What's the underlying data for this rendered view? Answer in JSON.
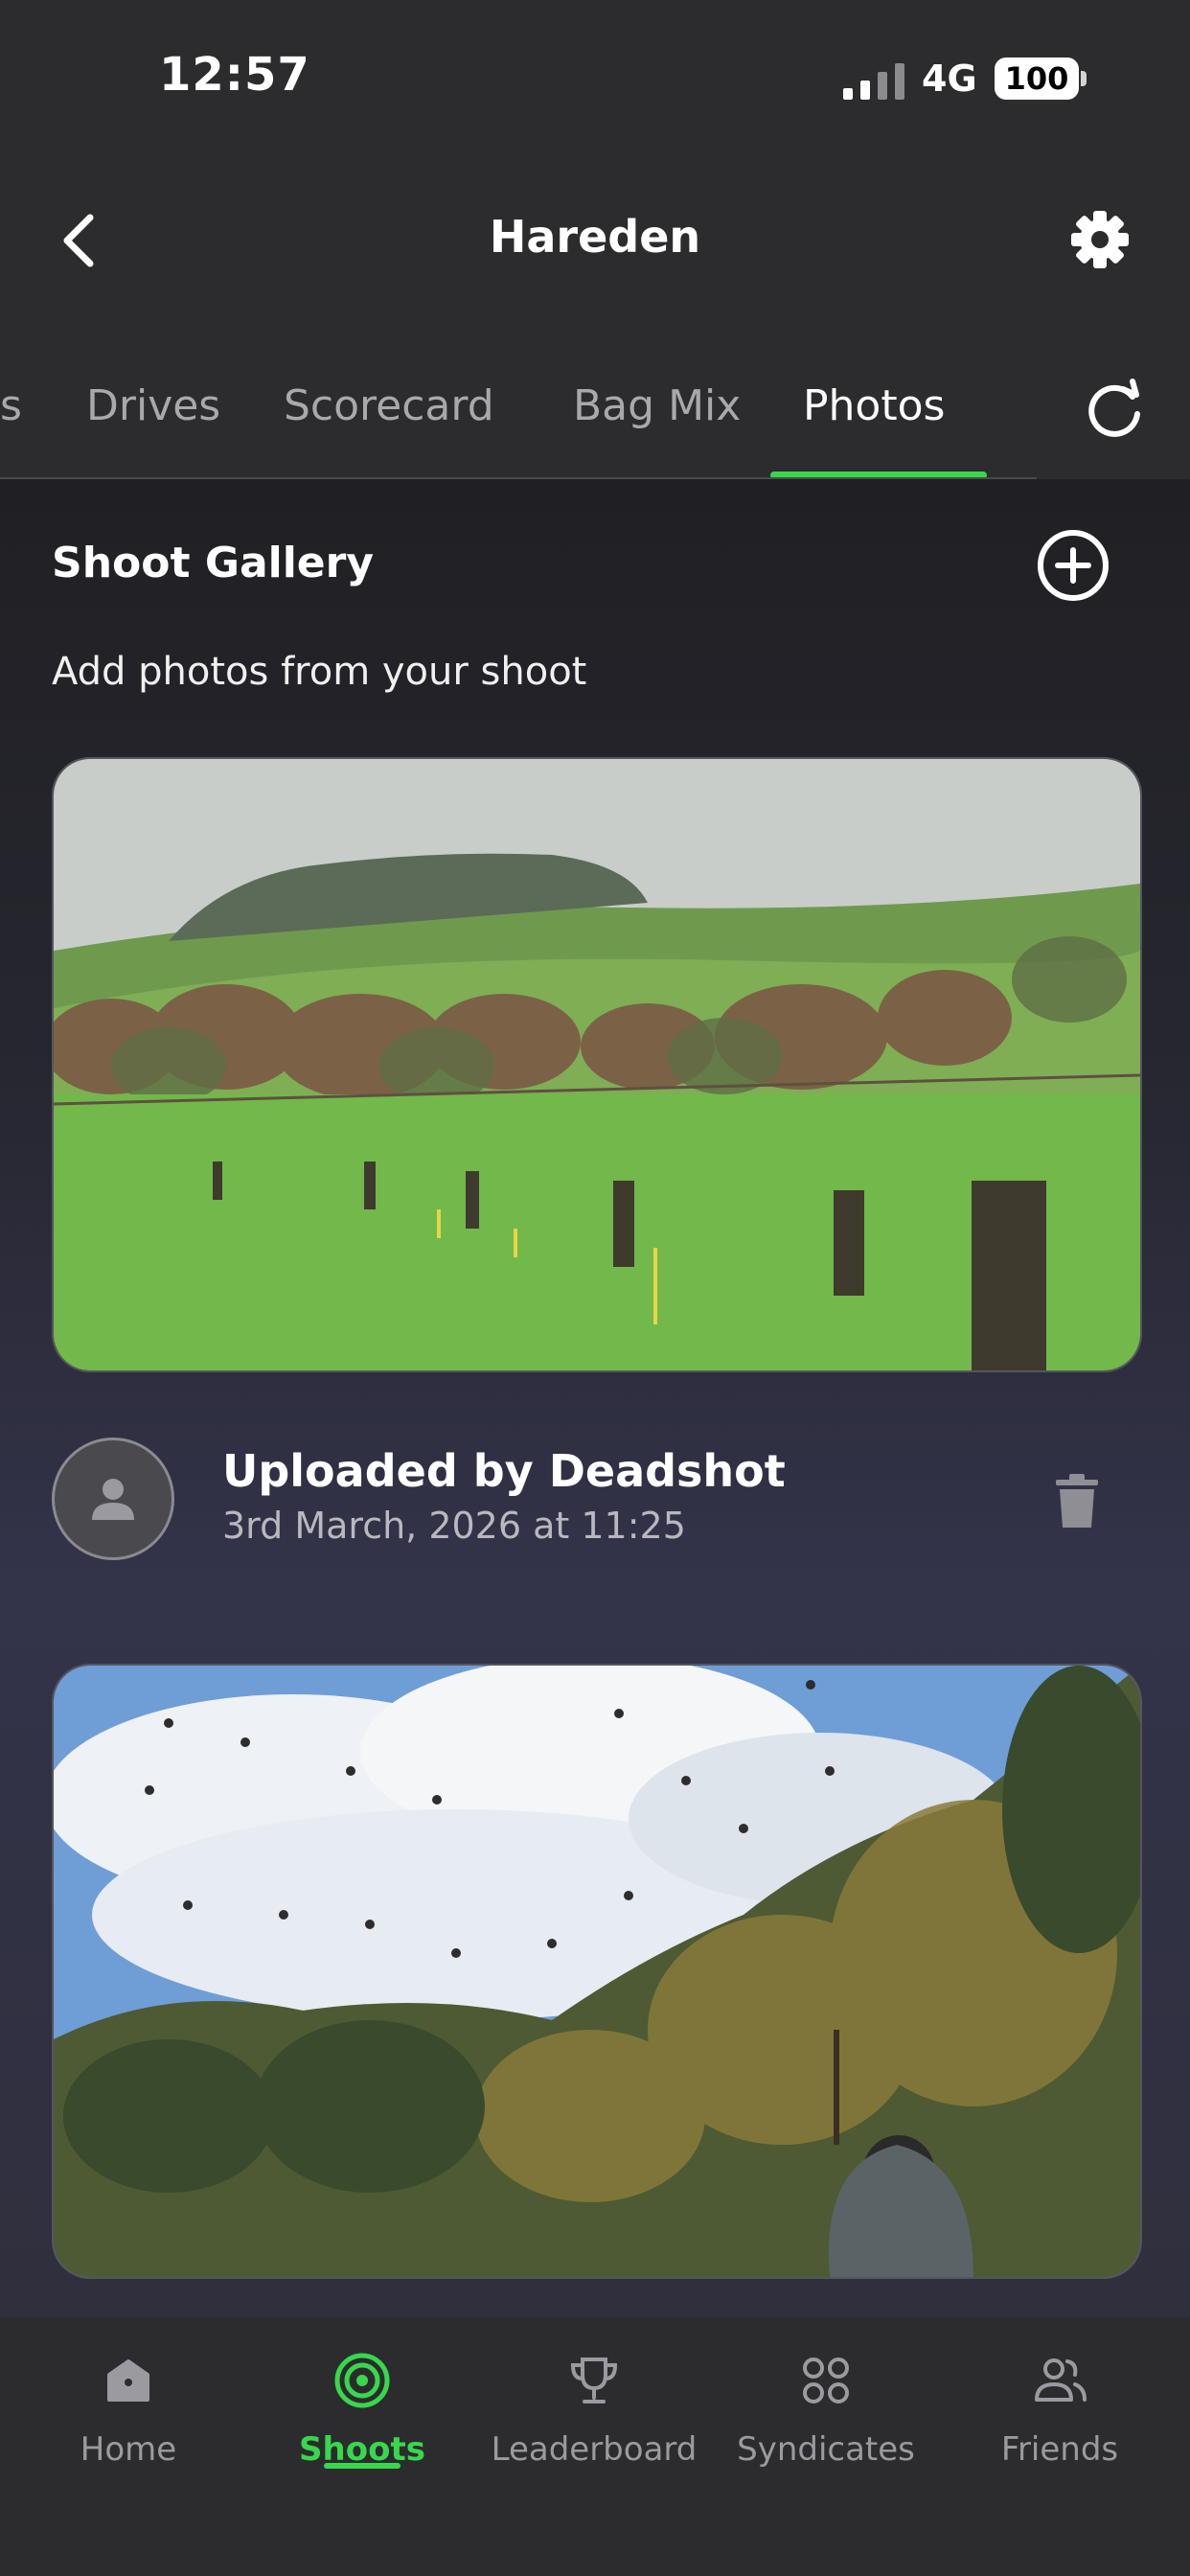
{
  "status_bar": {
    "time": "12:57",
    "network": "4G",
    "battery": "100"
  },
  "header": {
    "title": "Hareden",
    "back_icon": "chevron-left-icon",
    "settings_icon": "gear-icon"
  },
  "tabs": {
    "items": [
      {
        "label": "s"
      },
      {
        "label": "Drives"
      },
      {
        "label": "Scorecard"
      },
      {
        "label": "Bag Mix"
      },
      {
        "label": "Photos"
      }
    ],
    "active": "Photos",
    "refresh_icon": "refresh-icon"
  },
  "gallery": {
    "title": "Shoot Gallery",
    "subtitle": "Add photos from your shoot",
    "add_icon": "plus-circle-icon",
    "photos": [
      {
        "uploaded_by": "Uploaded by Deadshot",
        "date": "3rd March, 2026 at 11:25"
      },
      {
        "uploaded_by": "",
        "date": ""
      }
    ]
  },
  "bottom_nav": {
    "items": [
      {
        "label": "Home",
        "icon": "home-icon"
      },
      {
        "label": "Shoots",
        "icon": "target-icon"
      },
      {
        "label": "Leaderboard",
        "icon": "trophy-icon"
      },
      {
        "label": "Syndicates",
        "icon": "grid-icon"
      },
      {
        "label": "Friends",
        "icon": "users-icon"
      }
    ],
    "active": "Shoots"
  },
  "colors": {
    "accent": "#37d84b",
    "background": "#2c2c2f"
  }
}
